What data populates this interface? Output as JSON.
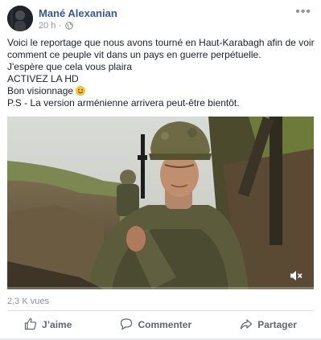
{
  "post": {
    "author": "Mané Alexanian",
    "time": "20 h ·",
    "text_lines": [
      "Voici le reportage que nous avons tourné en Haut-Karabagh afin de voir",
      "comment ce peuple vit dans un pays en guerre perpétuelle.",
      "J'espère que cela vous plaira",
      "ACTIVEZ LA HD",
      "Bon visionnage",
      "P.S - La version arménienne arrivera peut-être bientôt."
    ],
    "views": "2,3 K vues"
  },
  "actions": {
    "like": "J’aime",
    "comment": "Commenter",
    "share": "Partager"
  },
  "icons": {
    "more": "more-options-icon",
    "globe": "globe-icon",
    "mute": "speaker-muted-icon",
    "like": "thumbs-up-icon",
    "comment": "comment-bubble-icon",
    "share": "share-arrow-icon"
  },
  "colors": {
    "author": "#385898",
    "meta": "#90949c",
    "action": "#606770"
  }
}
